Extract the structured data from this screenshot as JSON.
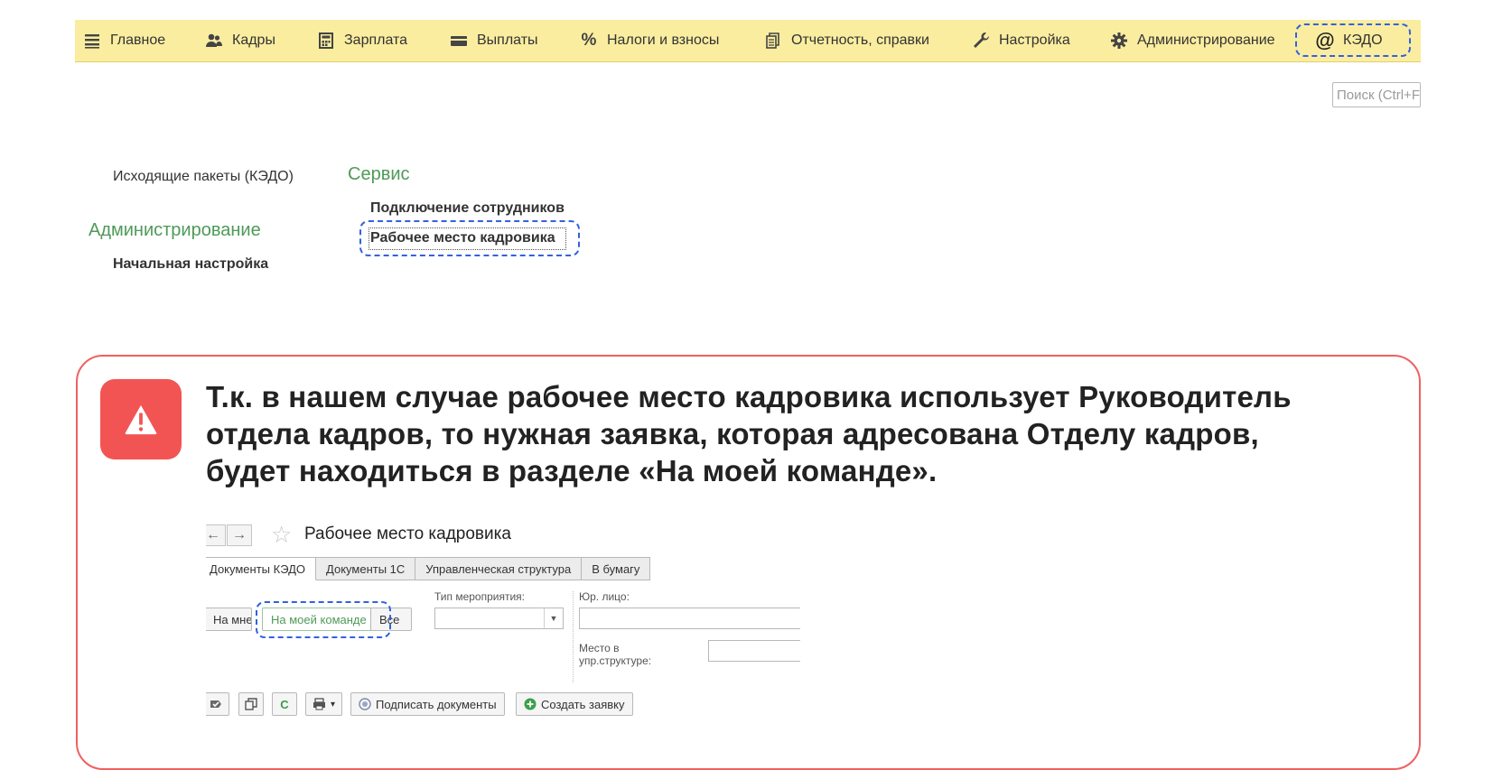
{
  "sections": [
    {
      "label": "Главное",
      "icon": "menu-lines-icon"
    },
    {
      "label": "Кадры",
      "icon": "people-icon"
    },
    {
      "label": "Зарплата",
      "icon": "calculator-icon"
    },
    {
      "label": "Выплаты",
      "icon": "wallet-icon"
    },
    {
      "label": "Налоги и взносы",
      "icon": "percent-icon"
    },
    {
      "label": "Отчетность, справки",
      "icon": "documents-icon"
    },
    {
      "label": "Настройка",
      "icon": "wrench-icon"
    },
    {
      "label": "Администрирование",
      "icon": "gear-icon"
    },
    {
      "label": "КЭДО",
      "icon": "at-sign-icon"
    }
  ],
  "search": {
    "placeholder": "Поиск (Ctrl+F)"
  },
  "menu": {
    "outgoing_packages": "Исходящие пакеты (КЭДО)",
    "admin_heading": "Администрирование",
    "initial_setup": "Начальная настройка",
    "service_heading": "Сервис",
    "employee_connection": "Подключение сотрудников",
    "hr_workplace": "Рабочее место кадровика"
  },
  "callout": {
    "icon": "warning-icon",
    "accent_color": "#f25454",
    "lines": [
      "Т.к. в нашем случае рабочее место кадровика использует Руководитель",
      "отдела кадров, то нужная заявка, которая адресована Отделу кадров,",
      "будет находиться в разделе «На моей команде»."
    ]
  },
  "shot": {
    "back": "←",
    "forward": "→",
    "title": "Рабочее место кадровика",
    "tabs": [
      "Документы КЭДО",
      "Документы 1С",
      "Управленческая структура",
      "В бумагу"
    ],
    "filters": {
      "mine": "На мне",
      "my_team": "На моей команде",
      "all": "Все"
    },
    "event_type_label": "Тип мероприятия:",
    "legal_entity_label": "Юр. лицо:",
    "place_label_1": "Место в",
    "place_label_2": "упр.структуре:",
    "dropdown_arrow": "▼",
    "toolbar": {
      "refresh": "C",
      "print": "▾",
      "sign": "Подписать документы",
      "create": "Создать заявку"
    }
  }
}
